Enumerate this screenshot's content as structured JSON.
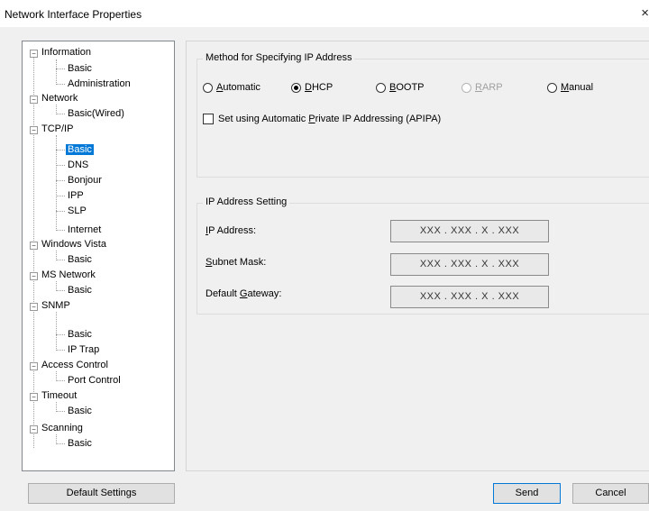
{
  "window": {
    "title": "Network Interface Properties",
    "close_glyph": "×"
  },
  "tree": {
    "information": "Information",
    "information_basic": "Basic",
    "information_admin": "Administration",
    "network": "Network",
    "network_basic": "Basic(Wired)",
    "tcpip": "TCP/IP",
    "tcpip_basic": "Basic",
    "tcpip_dns": "DNS",
    "tcpip_bonjour": "Bonjour",
    "tcpip_ipp": "IPP",
    "tcpip_slp": "SLP",
    "tcpip_internet": "Internet",
    "vista": "Windows Vista",
    "vista_basic": "Basic",
    "msnet": "MS Network",
    "msnet_basic": "Basic",
    "snmp": "SNMP",
    "snmp_basic": "Basic",
    "snmp_trap": "IP Trap",
    "access": "Access Control",
    "access_port": "Port Control",
    "timeout": "Timeout",
    "timeout_basic": "Basic",
    "scanning": "Scanning",
    "scanning_basic": "Basic"
  },
  "method_group": {
    "title": "Method for Specifying IP Address",
    "automatic": {
      "ul": "A",
      "rest": "utomatic"
    },
    "dhcp": {
      "ul": "D",
      "rest": "HCP"
    },
    "bootp": {
      "ul": "B",
      "rest": "OOTP"
    },
    "rarp": {
      "ul": "R",
      "rest": "ARP"
    },
    "manual": {
      "ul": "M",
      "rest": "anual"
    },
    "apipa": {
      "before": "Set using Automatic ",
      "ul": "P",
      "rest": "rivate IP Addressing (APIPA)"
    },
    "selected": "DHCP"
  },
  "ip_group": {
    "title": "IP Address Setting",
    "ip_label": {
      "ul": "I",
      "rest": "P Address:"
    },
    "subnet_label": {
      "ul": "S",
      "rest": "ubnet Mask:"
    },
    "gateway_label": {
      "before": "Default ",
      "ul": "G",
      "rest": "ateway:"
    },
    "ip_value": "XXX . XXX . X . XXX",
    "subnet_value": "XXX . XXX . X . XXX",
    "gateway_value": "XXX . XXX . X . XXX"
  },
  "buttons": {
    "default_settings": "Default Settings",
    "send": "Send",
    "cancel": "Cancel"
  },
  "colors": {
    "selection": "#0078d7",
    "window_bg": "#f0f0f0"
  }
}
